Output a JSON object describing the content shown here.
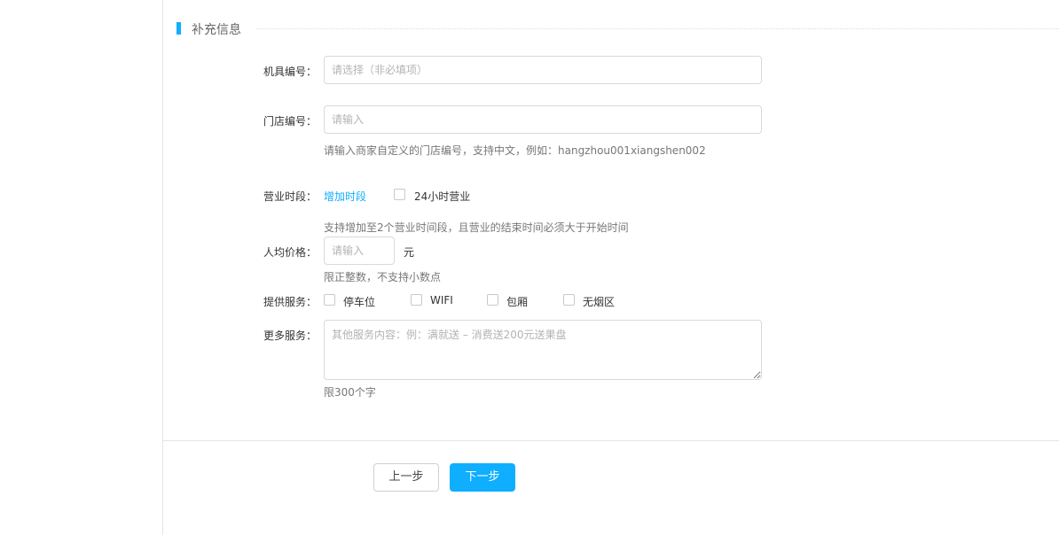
{
  "section": {
    "title": "补充信息"
  },
  "form": {
    "machine_no": {
      "label": "机具编号：",
      "placeholder": "请选择（非必填项）"
    },
    "store_no": {
      "label": "门店编号：",
      "placeholder": "请输入",
      "hint": "请输入商家自定义的门店编号，支持中文，例如：hangzhou001xiangshen002"
    },
    "hours": {
      "label": "营业时段：",
      "add_link": "增加时段",
      "all_day_label": "24小时营业",
      "hint": "支持增加至2个营业时间段，且营业的结束时间必须大于开始时间"
    },
    "price": {
      "label": "人均价格：",
      "placeholder": "请输入",
      "unit": "元",
      "hint": "限正整数，不支持小数点"
    },
    "services": {
      "label": "提供服务：",
      "options": [
        "停车位",
        "WIFI",
        "包厢",
        "无烟区"
      ]
    },
    "more_services": {
      "label": "更多服务：",
      "placeholder": "其他服务内容：例：满就送 – 消费送200元送果盘",
      "hint": "限300个字"
    }
  },
  "footer": {
    "prev_label": "上一步",
    "next_label": "下一步"
  },
  "colors": {
    "accent": "#10aeff",
    "border": "#d9d9d9",
    "hint_text": "#777777"
  }
}
